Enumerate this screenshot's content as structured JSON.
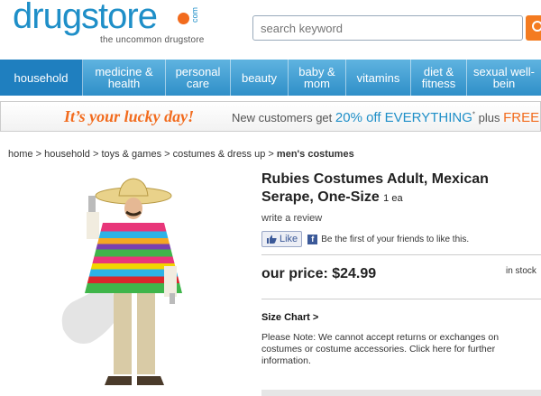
{
  "header": {
    "logo_word": "drugstore",
    "logo_com": "com",
    "logo_tagline": "the uncommon drugstore",
    "search_placeholder": "search keyword"
  },
  "nav": {
    "items": [
      {
        "label": "household",
        "active": true
      },
      {
        "label": "medicine & health"
      },
      {
        "label": "personal care"
      },
      {
        "label": "beauty"
      },
      {
        "label": "baby & mom"
      },
      {
        "label": "vitamins"
      },
      {
        "label": "diet & fitness"
      },
      {
        "label": "sexual well-bein"
      }
    ]
  },
  "promo": {
    "lucky": "It’s your lucky day!",
    "text1": "New customers get",
    "offer": "20% off EVERYTHING",
    "mark": "*",
    "text2": "plus",
    "free": "FREE"
  },
  "breadcrumb": {
    "items": [
      "home",
      "household",
      "toys & games",
      "costumes & dress up"
    ],
    "separator": ">",
    "current": "men's costumes"
  },
  "product": {
    "title": "Rubies Costumes Adult, Mexican Serape, One-Size",
    "unit": "1 ea",
    "write_review": "write a review",
    "like_label": "Like",
    "fb_text": "Be the first of your friends to like this.",
    "price_label": "our price: $24.99",
    "stock": "in stock",
    "size_chart": "Size Chart >",
    "note": "Please Note: We cannot accept returns or exchanges on costumes or costume accessories. Click here for further information."
  },
  "colors": {
    "brand_blue": "#1f8fc8",
    "brand_orange": "#f26b1d",
    "nav_blue": "#2f8fc8"
  }
}
